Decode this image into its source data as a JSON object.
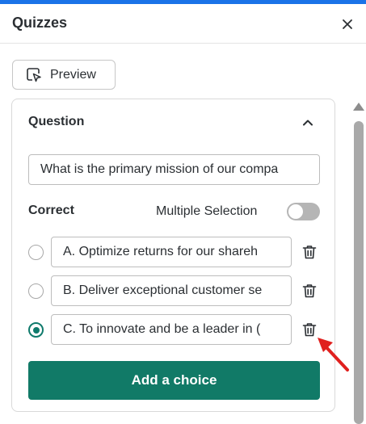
{
  "header": {
    "title": "Quizzes"
  },
  "toolbar": {
    "preview_label": "Preview"
  },
  "question_card": {
    "title": "Question",
    "question_value": "What is the primary mission of our compa",
    "correct_label": "Correct",
    "multiple_selection_label": "Multiple Selection",
    "multiple_selection_on": false,
    "choices": [
      {
        "text": "A. Optimize returns for our shareh",
        "selected": false
      },
      {
        "text": "B. Deliver exceptional customer se",
        "selected": false
      },
      {
        "text": "C. To innovate and be a leader in (",
        "selected": true
      }
    ],
    "add_choice_label": "Add a choice"
  },
  "colors": {
    "accent_bar": "#1a73e8",
    "primary_button": "#117a67",
    "radio_selected": "#0f7a6c",
    "annotation_arrow": "#e0201e"
  }
}
